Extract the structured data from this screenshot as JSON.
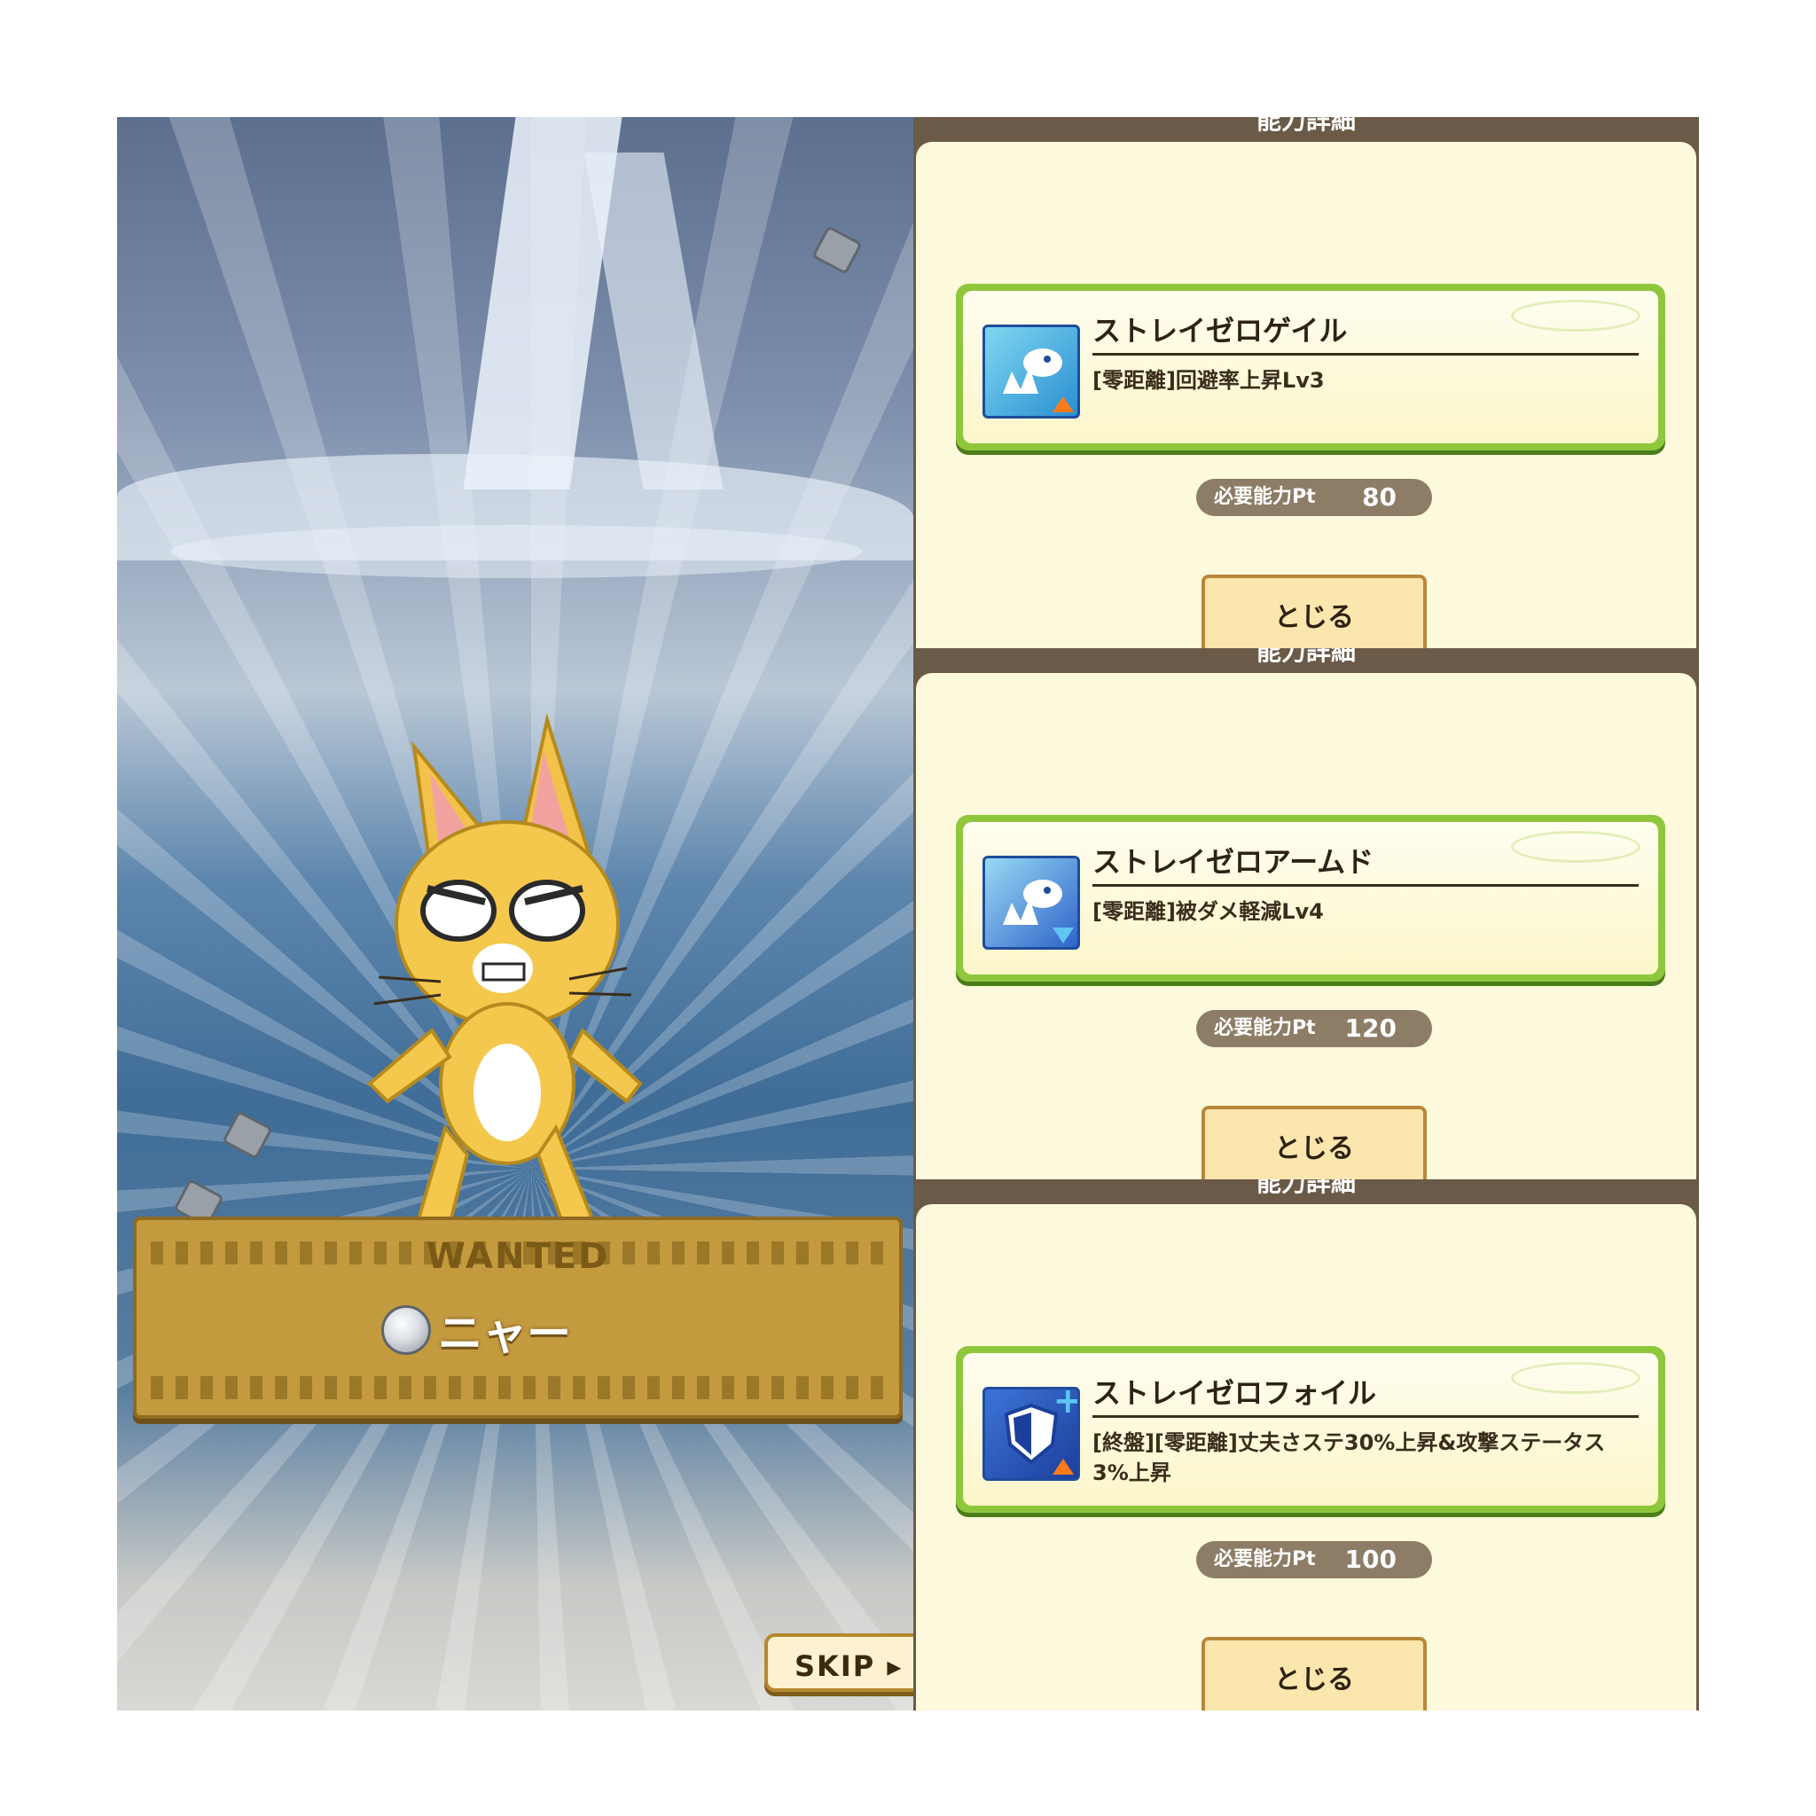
{
  "left_scene": {
    "wanted_title": "WANTED",
    "target_name": "ニャー",
    "skip_label": "SKIP ▸"
  },
  "dialogs": [
    {
      "header": "能力詳細",
      "skill_name": "ストレイゼロゲイル",
      "skill_desc": "[零距離]回避率上昇Lv3",
      "req_label": "必要能力Pt",
      "req_value": "80",
      "close_label": "とじる",
      "icon": "zero-distance-evasion-up-icon"
    },
    {
      "header": "能力詳細",
      "skill_name": "ストレイゼロアームド",
      "skill_desc": "[零距離]被ダメ軽減Lv4",
      "req_label": "必要能力Pt",
      "req_value": "120",
      "close_label": "とじる",
      "icon": "zero-distance-damage-reduction-icon"
    },
    {
      "header": "能力詳細",
      "skill_name": "ストレイゼロフォイル",
      "skill_desc": "[終盤][零距離]丈夫さステ30%上昇&攻撃ステータス3%上昇",
      "req_label": "必要能力Pt",
      "req_value": "100",
      "close_label": "とじる",
      "icon": "shield-plus-icon"
    }
  ]
}
